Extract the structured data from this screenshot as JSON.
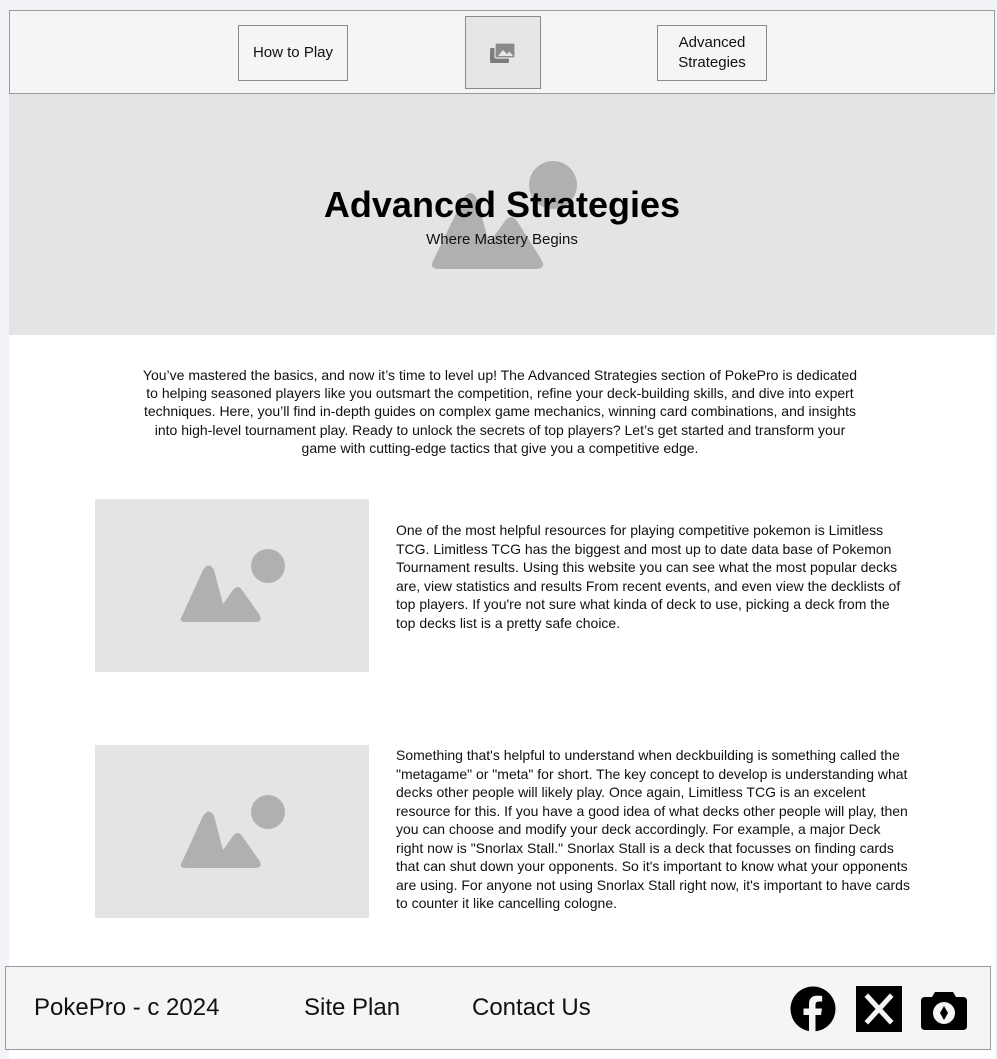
{
  "nav": {
    "how_to_play": "How to Play",
    "logo_icon": "image-gallery-icon",
    "advanced_strategies": "Advanced Strategies"
  },
  "hero": {
    "title": "Advanced Strategies",
    "subtitle": "Where Mastery Begins",
    "image_icon": "image-placeholder-icon"
  },
  "intro": "You’ve mastered the basics, and now it’s time to level up! The Advanced Strategies section of PokePro is dedicated to helping seasoned players like you outsmart the competition, refine your deck-building skills, and dive into expert techniques. Here, you’ll find in-depth guides on complex game mechanics, winning card combinations, and insights into high-level tournament play. Ready to unlock the secrets of top players? Let’s get started and transform your game with cutting-edge tactics that give you a competitive edge.",
  "sections": [
    {
      "image_icon": "image-placeholder-icon",
      "text": "One of the most helpful resources for playing competitive pokemon is Limitless TCG. Limitless TCG has the biggest and most up to date data base of Pokemon Tournament results. Using this website you can see what the most popular decks are, view statistics and results From recent events, and even view the decklists of top players. If you're not sure what kinda of deck to use, picking a deck from the top decks list is a pretty safe choice."
    },
    {
      "image_icon": "image-placeholder-icon",
      "text": "Something that's helpful to understand when deckbuilding is something called the \"metagame\" or \"meta\" for short. The key concept to develop is understanding what decks other people will likely play. Once again, Limitless TCG is an excelent resource for this. If you have a good idea of what decks other people will play, then you can choose and modify your deck accordingly. For example, a major Deck right now is \"Snorlax Stall.\" Snorlax Stall is a deck that focusses on finding cards that can shut down your opponents. So it's important to know what your opponents are using. For anyone not using Snorlax Stall right now, it's important to have cards to counter it like cancelling cologne."
    }
  ],
  "footer": {
    "copyright": "PokePro - c 2024",
    "site_plan": "Site Plan",
    "contact_us": "Contact Us",
    "social_icons": [
      "facebook-icon",
      "x-icon",
      "camera-icon"
    ]
  },
  "colors": {
    "placeholder_bg": "#e4e4e4",
    "placeholder_shape": "#b0b0b0",
    "bar_bg": "#f5f5f5",
    "border": "#9a9a9a"
  }
}
